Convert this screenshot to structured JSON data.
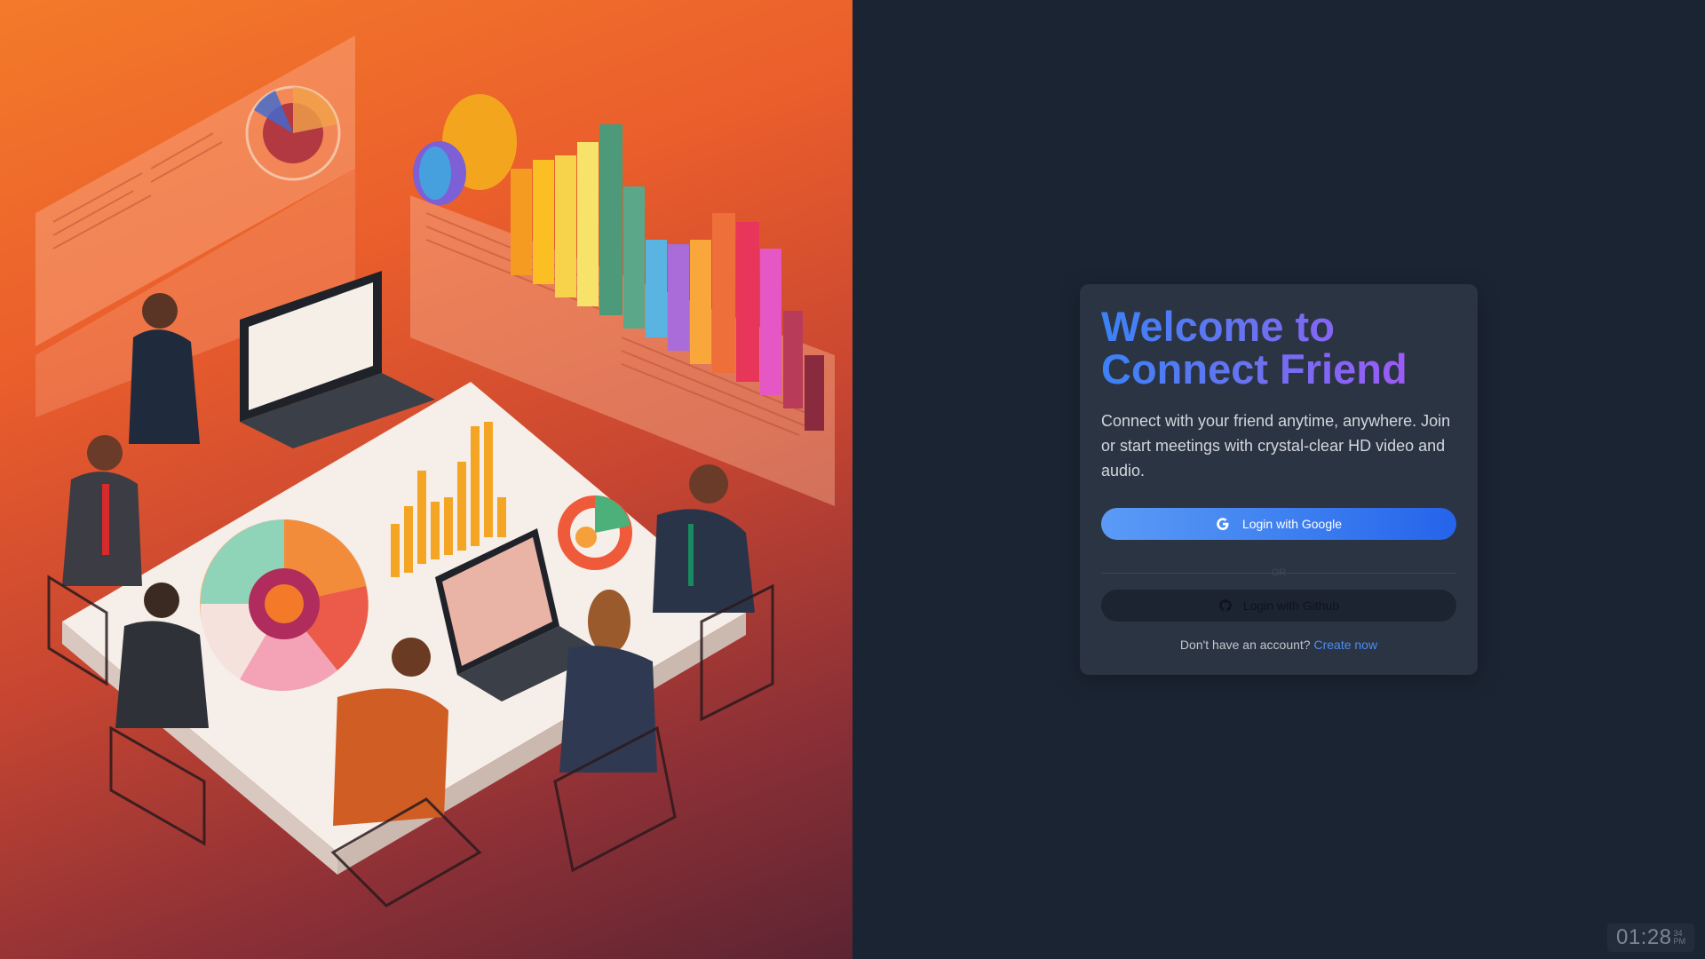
{
  "hero": {
    "alt": "Isometric illustration of a business team meeting with charts"
  },
  "login": {
    "title_line1": "Welcome to",
    "title_line2": "Connect Friend",
    "subtitle": "Connect with your friend anytime, anywhere. Join or start meetings with crystal-clear HD video and audio.",
    "google_button_label": "Login with Google",
    "divider_label": "OR",
    "github_button_label": "Login with Github",
    "signup_prompt": "Don't have an account?",
    "signup_link": "Create now"
  },
  "clock": {
    "time": "01:28",
    "seconds": "34",
    "meridiem": "PM"
  },
  "colors": {
    "panel_background": "#1b2432",
    "card_background": "#2b3442",
    "google_button": "#3d7ff0",
    "github_button": "#1c2331",
    "link": "#4a8df5",
    "title_gradient_start": "#3b82f6",
    "title_gradient_end": "#a855f7"
  },
  "icons": {
    "google": "google-icon",
    "github": "github-icon"
  }
}
